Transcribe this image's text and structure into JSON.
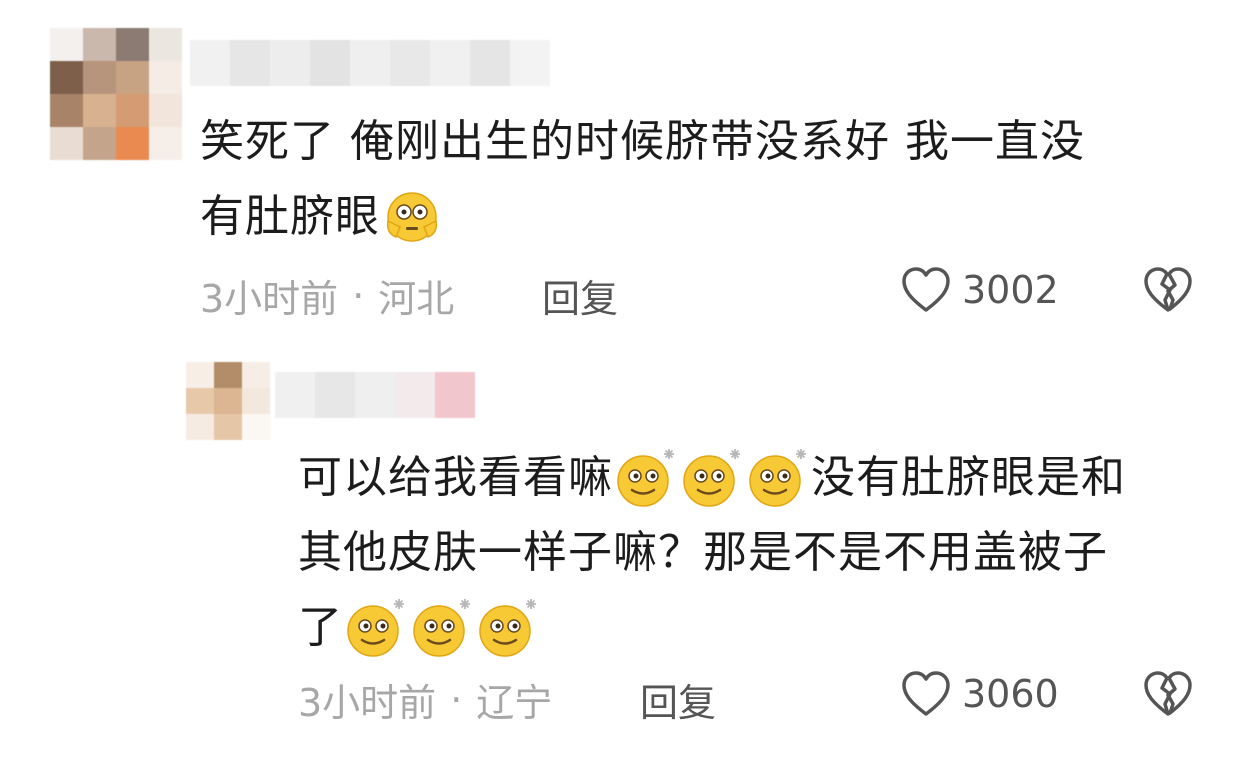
{
  "comments": [
    {
      "text_line1": "笑死了 俺刚出生的时候脐带没系好 我一直没",
      "text_line2": "有肚脐眼",
      "emoji": "flushed-face-icon",
      "time": "3小时前",
      "location": "河北",
      "reply_label": "回复",
      "likes": "3002"
    },
    {
      "text_line1": "可以给我看看嘛",
      "text_line1_end": "没有肚脐眼是和",
      "text_line2": "其他皮肤一样子嘛？那是不是不用盖被子",
      "text_line3": "了",
      "emoji": "sparkle-smile-icon",
      "time": "3小时前",
      "location": "辽宁",
      "reply_label": "回复",
      "likes": "3060"
    }
  ],
  "colors": {
    "text": "#1c1c1c",
    "meta": "#a7a7a7",
    "action": "#555555",
    "emoji_yellow": "#f7c934"
  }
}
